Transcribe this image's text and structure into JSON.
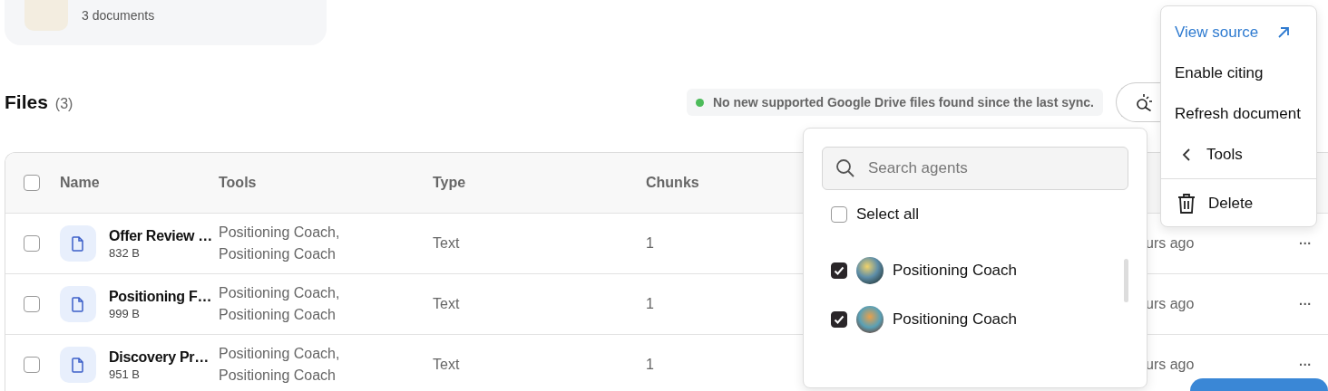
{
  "collection_card": {
    "subtitle": "3 documents"
  },
  "files_header": {
    "title": "Files",
    "count": "(3)"
  },
  "sync_notice": {
    "text": "No new supported Google Drive files found since the last sync."
  },
  "table": {
    "columns": [
      "Name",
      "Tools",
      "Type",
      "Chunks"
    ],
    "all_checked": false,
    "rows": [
      {
        "name": "Offer Review …",
        "size": "832 B",
        "tools": [
          "Positioning Coach,",
          "Positioning Coach"
        ],
        "type": "Text",
        "chunks": "1",
        "column_5": "urs ago",
        "checked": false,
        "menu": "···"
      },
      {
        "name": "Positioning F…",
        "size": "999 B",
        "tools": [
          "Positioning Coach,",
          "Positioning Coach"
        ],
        "type": "Text",
        "chunks": "1",
        "column_5": "urs ago",
        "checked": false,
        "menu": "···"
      },
      {
        "name": "Discovery Pr…",
        "size": "951 B",
        "tools": [
          "Positioning Coach,",
          "Positioning Coach"
        ],
        "type": "Text",
        "chunks": "1",
        "column_5": "urs ago",
        "checked": false,
        "menu": "···"
      }
    ]
  },
  "agent_picker": {
    "search": {
      "placeholder": "Search agents"
    },
    "select_all": {
      "label": "Select all",
      "checked": false
    },
    "agents": [
      {
        "name": "Positioning Coach",
        "checked": true
      },
      {
        "name": "Positioning Coach",
        "checked": true
      }
    ]
  },
  "context_menu": {
    "items": [
      {
        "kind": "link",
        "label": "View source"
      },
      {
        "kind": "plain",
        "label": "Enable citing"
      },
      {
        "kind": "plain",
        "label": "Refresh document"
      },
      {
        "kind": "back",
        "label": "Tools"
      },
      {
        "kind": "danger",
        "label": "Delete"
      }
    ]
  }
}
